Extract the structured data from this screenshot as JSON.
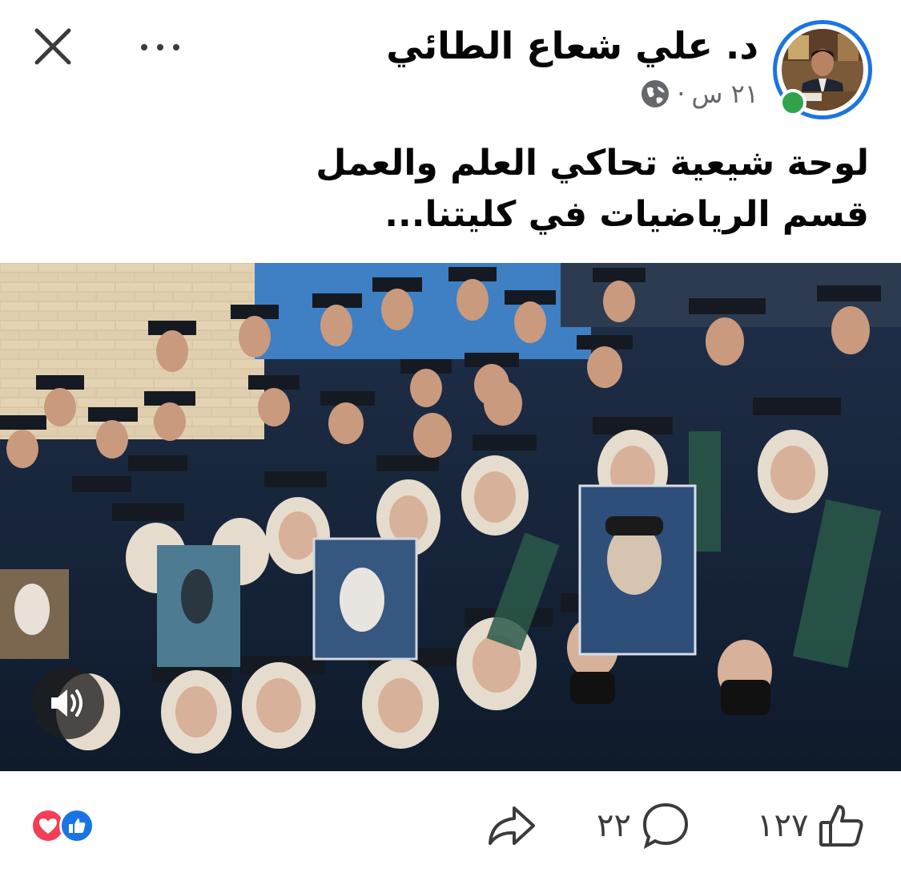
{
  "post": {
    "author": "د. علي شعاع الطائي",
    "time": "٢١ س",
    "separator": "·",
    "text_lines": [
      "لوحة شيعية تحاكي العلم والعمل",
      "قسم الرياضيات في كليتنا..."
    ]
  },
  "icons": {
    "close": "close-icon",
    "more": "more-icon",
    "privacy": "globe-icon",
    "sound": "speaker-icon",
    "like": "thumbs-up-icon",
    "comment": "comment-icon",
    "share": "share-icon"
  },
  "stats": {
    "likes": "١٢٧",
    "comments": "٢٢"
  },
  "colors": {
    "accent": "#1b74e4",
    "online": "#31a24c",
    "love": "#f33e58",
    "muted_text": "#65676b"
  }
}
